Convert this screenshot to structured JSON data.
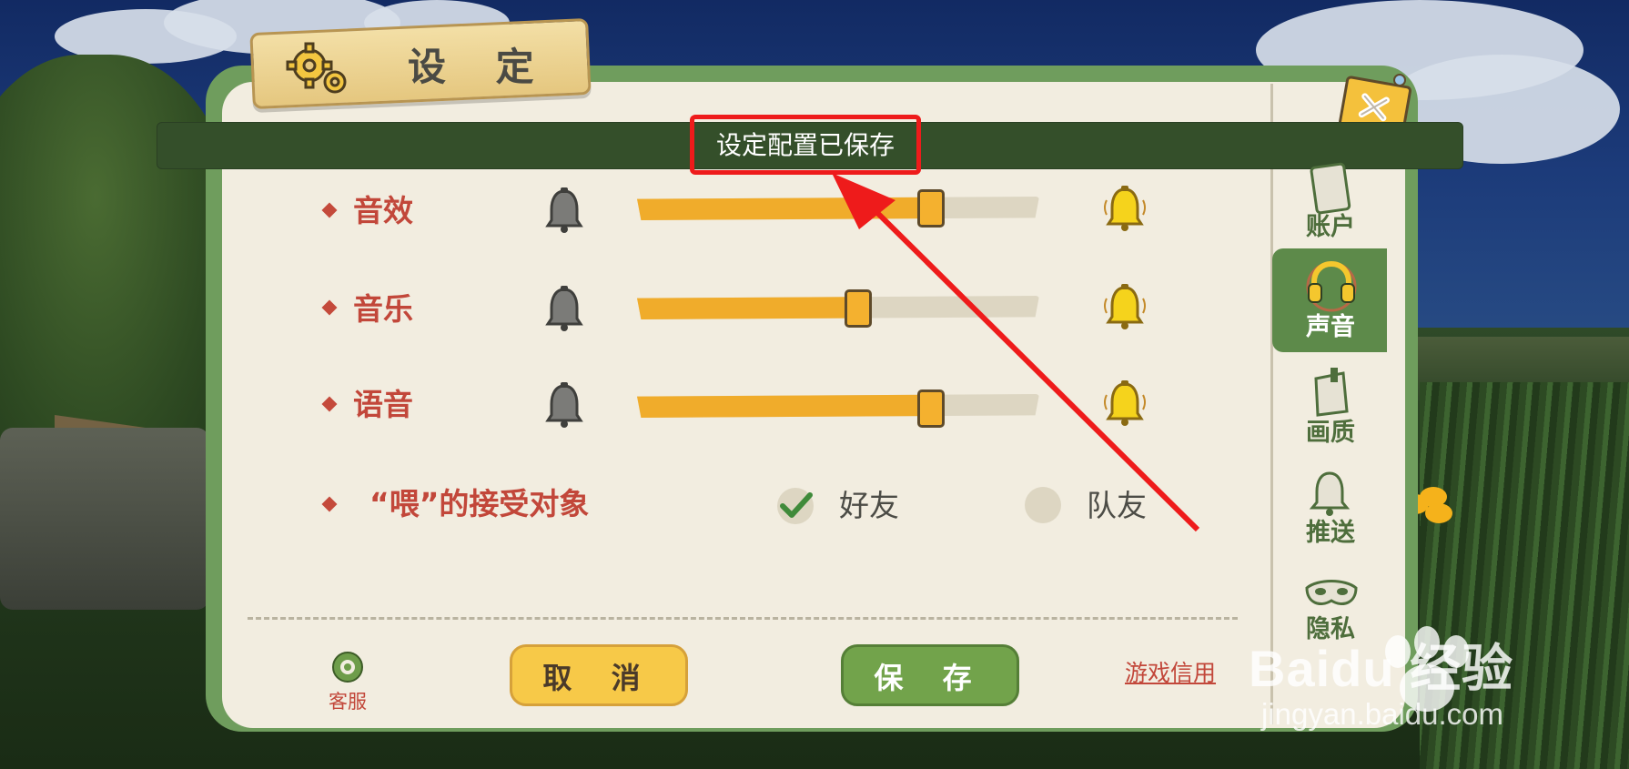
{
  "title": "设 定",
  "toast": {
    "message": "设定配置已保存"
  },
  "sliders": [
    {
      "label": "音效",
      "level": 0.73
    },
    {
      "label": "音乐",
      "level": 0.55
    },
    {
      "label": "语音",
      "level": 0.73
    }
  ],
  "feed_target": {
    "label": "“喂”的接受对象",
    "options": [
      {
        "label": "好友",
        "selected": true
      },
      {
        "label": "队友",
        "selected": false
      }
    ]
  },
  "footer": {
    "customer_service": "客服",
    "cancel": "取 消",
    "save": "保 存",
    "credit_link": "游戏信用"
  },
  "sidebar": {
    "active_index": 1,
    "items": [
      {
        "label": "账户",
        "icon": "card-icon"
      },
      {
        "label": "声音",
        "icon": "headphones-icon"
      },
      {
        "label": "画质",
        "icon": "paper-icon"
      },
      {
        "label": "推送",
        "icon": "bell-icon"
      },
      {
        "label": "隐私",
        "icon": "mask-icon"
      }
    ]
  },
  "watermark": {
    "brand": "Baidu 经验",
    "url": "jingyan.baidu.com"
  },
  "colors": {
    "accent_red": "#c2473a",
    "slider_fill": "#f0ac2b",
    "panel_green": "#6f9d5d",
    "toast_bg": "#344f2a",
    "annotation_red": "#ee1b1b"
  }
}
